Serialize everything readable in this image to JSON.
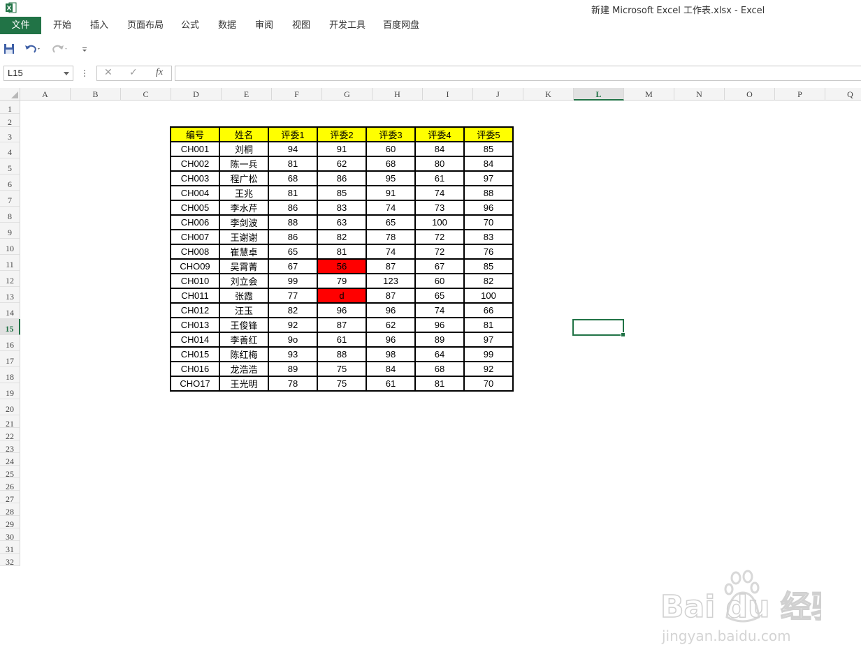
{
  "window": {
    "title": "新建 Microsoft Excel 工作表.xlsx - Excel"
  },
  "ribbon": {
    "tabs": [
      "文件",
      "开始",
      "插入",
      "页面布局",
      "公式",
      "数据",
      "审阅",
      "视图",
      "开发工具",
      "百度网盘"
    ]
  },
  "formula_bar": {
    "name_box": "L15",
    "cancel_icon": "✕",
    "enter_icon": "✓",
    "fx_label": "fx",
    "value": ""
  },
  "columns": [
    "A",
    "B",
    "C",
    "D",
    "E",
    "F",
    "G",
    "H",
    "I",
    "J",
    "K",
    "L",
    "M",
    "N",
    "O",
    "P",
    "Q"
  ],
  "selected_column": "L",
  "rows": [
    "1",
    "2",
    "3",
    "4",
    "5",
    "6",
    "7",
    "8",
    "9",
    "10",
    "11",
    "12",
    "13",
    "14",
    "15",
    "16",
    "17",
    "18",
    "19",
    "20",
    "21",
    "22",
    "23",
    "24",
    "25",
    "26",
    "27",
    "28",
    "29",
    "30",
    "31",
    "32"
  ],
  "selected_row": "15",
  "table": {
    "headers": [
      "编号",
      "姓名",
      "评委1",
      "评委2",
      "评委3",
      "评委4",
      "评委5"
    ],
    "rows": [
      [
        "CH001",
        "刘桐",
        "94",
        "91",
        "60",
        "84",
        "85"
      ],
      [
        "CH002",
        "陈一兵",
        "81",
        "62",
        "68",
        "80",
        "84"
      ],
      [
        "CH003",
        "程广松",
        "68",
        "86",
        "95",
        "61",
        "97"
      ],
      [
        "CH004",
        "王兆",
        "81",
        "85",
        "91",
        "74",
        "88"
      ],
      [
        "CH005",
        "李水芹",
        "86",
        "83",
        "74",
        "73",
        "96"
      ],
      [
        "CH006",
        "李剑波",
        "88",
        "63",
        "65",
        "100",
        "70"
      ],
      [
        "CH007",
        "王谢谢",
        "86",
        "82",
        "78",
        "72",
        "83"
      ],
      [
        "CH008",
        "崔慧卓",
        "65",
        "81",
        "74",
        "72",
        "76"
      ],
      [
        "CHO09",
        "吴霄菁",
        "67",
        "56",
        "87",
        "67",
        "85"
      ],
      [
        "CH010",
        "刘立会",
        "99",
        "79",
        "123",
        "60",
        "82"
      ],
      [
        "CH011",
        "张霞",
        "77",
        "d",
        "87",
        "65",
        "100"
      ],
      [
        "CH012",
        "汪玉",
        "82",
        "96",
        "96",
        "74",
        "66"
      ],
      [
        "CH013",
        "王俊锋",
        "92",
        "87",
        "62",
        "96",
        "81"
      ],
      [
        "CH014",
        "李善红",
        "9o",
        "61",
        "96",
        "89",
        "97"
      ],
      [
        "CH015",
        "陈红梅",
        "93",
        "88",
        "98",
        "64",
        "99"
      ],
      [
        "CH016",
        "龙浩浩",
        "89",
        "75",
        "84",
        "68",
        "92"
      ],
      [
        "CHO17",
        "王光明",
        "78",
        "75",
        "61",
        "81",
        "70"
      ]
    ],
    "highlighted_cells": [
      [
        8,
        3
      ],
      [
        10,
        3
      ]
    ]
  },
  "colors": {
    "accent": "#217346",
    "header_fill": "#ffff00",
    "highlight_fill": "#ff0000"
  },
  "watermark": {
    "text_main": "Bai du 经验",
    "text_sub": "jingyan.baidu.com"
  }
}
